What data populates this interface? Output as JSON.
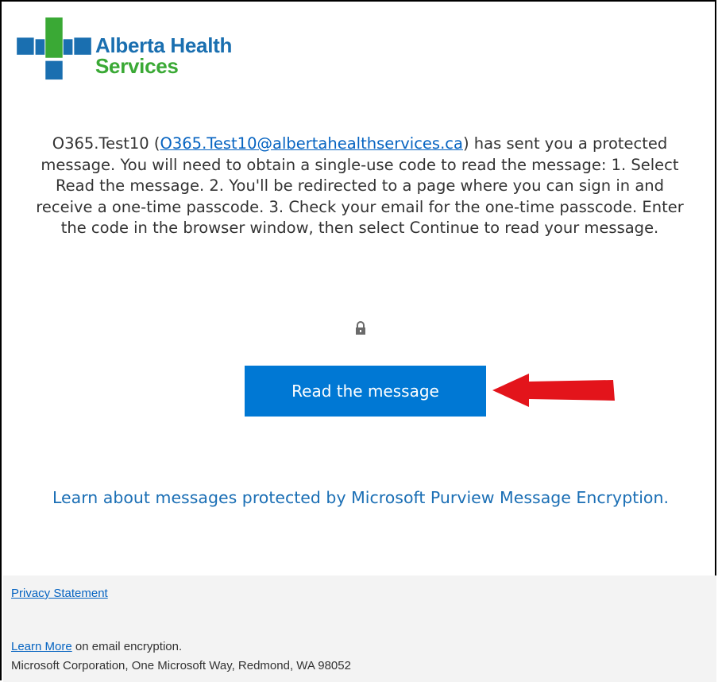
{
  "brand": {
    "name_line1": "Alberta Health",
    "name_line2": "Services",
    "colors": {
      "blue": "#1a6fb0",
      "green": "#3aa935",
      "cross_green": "#3aa935"
    }
  },
  "message": {
    "sender_name": "O365.Test10 (",
    "sender_email": "O365.Test10@albertahealthservices.ca",
    "body": ") has sent you a protected message. You will need to obtain a single-use code to read the message: 1. Select Read the message. 2. You'll be redirected to a page where you can sign in and receive a one-time passcode. 3. Check your email for the one-time passcode. Enter the code in the browser window, then select Continue to read your message."
  },
  "lock_icon": "lock-icon",
  "read_button": {
    "label": "Read the message",
    "color": "#0078d4"
  },
  "annotation_arrow": {
    "color": "#e3141b",
    "icon": "arrow-left-icon"
  },
  "learn_link": {
    "text": "Learn about messages protected by Microsoft Purview Message Encryption."
  },
  "footer": {
    "privacy": "Privacy Statement",
    "learn_more_link": "Learn More",
    "learn_more_rest": " on email encryption.",
    "address": "Microsoft Corporation, One Microsoft Way, Redmond, WA 98052"
  }
}
